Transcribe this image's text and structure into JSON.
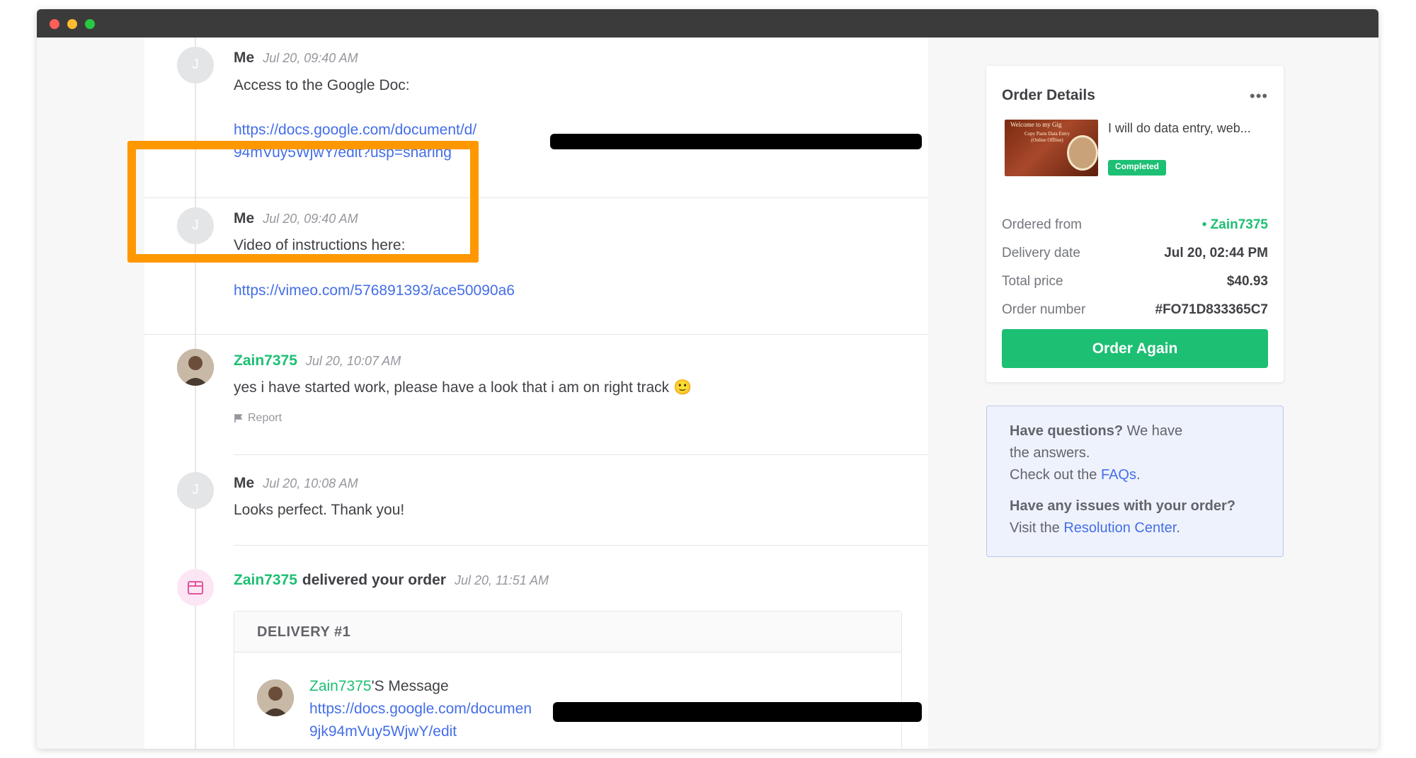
{
  "feed": {
    "messages": [
      {
        "avatar_initial": "J",
        "sender": "Me",
        "time": "Jul 20, 09:40 AM",
        "text": "Access to the Google Doc:",
        "link_line1": "https://docs.google.com/document/d/",
        "link_line2": "94mVuy5WjwY/edit?usp=sharing"
      },
      {
        "avatar_initial": "J",
        "sender": "Me",
        "time": "Jul 20, 09:40 AM",
        "text": "Video of instructions here:",
        "link": "https://vimeo.com/576891393/ace50090a6"
      },
      {
        "sender": "Zain7375",
        "time": "Jul 20, 10:07 AM",
        "text": "yes i have started work, please have a look that i am on right track 🙂",
        "report_label": "Report"
      },
      {
        "avatar_initial": "J",
        "sender": "Me",
        "time": "Jul 20, 10:08 AM",
        "text": "Looks perfect. Thank you!"
      }
    ],
    "delivery_event": {
      "sender": "Zain7375",
      "action": "delivered your order",
      "time": "Jul 20, 11:51 AM",
      "delivery_title": "DELIVERY #1",
      "message_sender": "Zain7375",
      "message_suffix": "'S Message",
      "link_line1": "https://docs.google.com/documen",
      "link_line2": "9jk94mVuy5WjwY/edit"
    }
  },
  "order_details": {
    "title": "Order Details",
    "menu_glyph": "•••",
    "thumb_title": "Welcome to my Gig",
    "thumb_sub": "Copy Paste Data Entry\n(Online Offline)",
    "gig_title": "I will do data entry, web...",
    "status": "Completed",
    "rows": [
      {
        "label": "Ordered from",
        "value": "• Zain7375"
      },
      {
        "label": "Delivery date",
        "value": "Jul 20, 02:44 PM"
      },
      {
        "label": "Total price",
        "value": "$40.93"
      },
      {
        "label": "Order number",
        "value": "#FO71D833365C7"
      }
    ],
    "button_label": "Order Again"
  },
  "help": {
    "q1_bold": "Have questions?",
    "q1_rest": " We have",
    "q1_line2": "the answers.",
    "faq_prefix": "Check out the ",
    "faq_link": "FAQs",
    "faq_suffix": ".",
    "q2_bold": "Have any issues with your order?",
    "res_prefix": "Visit the ",
    "res_link": "Resolution Center",
    "res_suffix": "."
  },
  "colors": {
    "accent_green": "#1dbf73",
    "link_blue": "#446ee7",
    "highlight_orange": "#ff9800"
  }
}
